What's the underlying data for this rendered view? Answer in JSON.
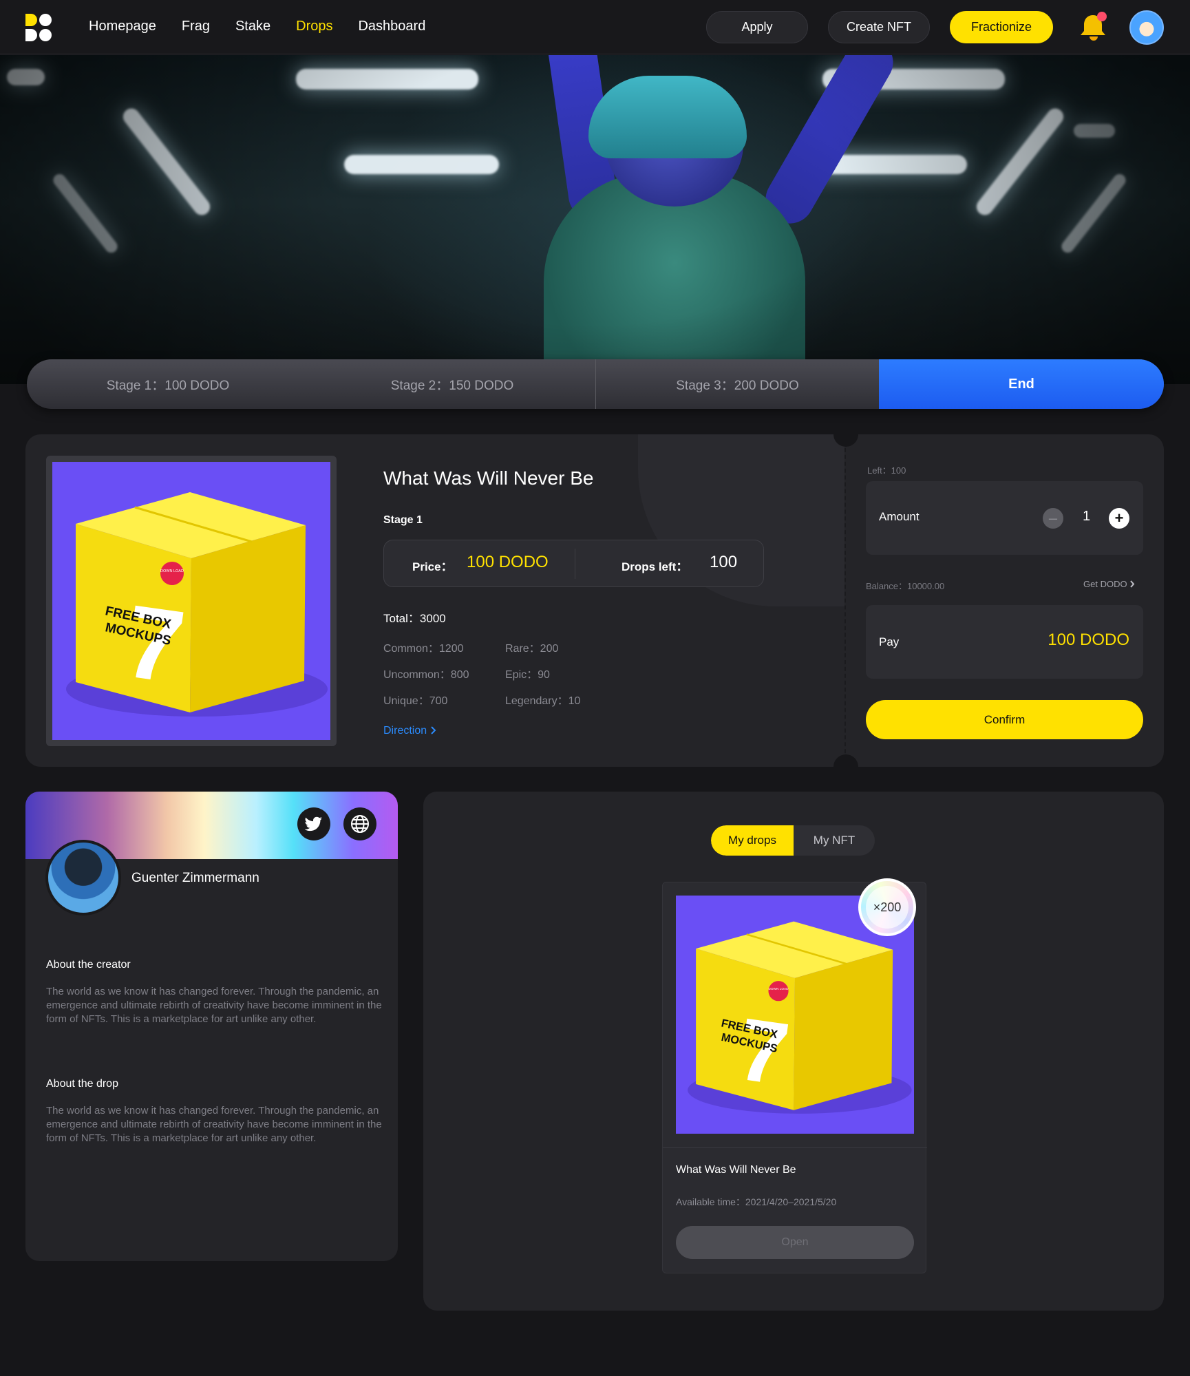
{
  "nav": {
    "links": [
      "Homepage",
      "Frag",
      "Stake",
      "Drops",
      "Dashboard"
    ],
    "active": "Drops",
    "apply_label": "Apply",
    "create_label": "Create NFT",
    "fractionize_label": "Fractionize"
  },
  "stages": {
    "s1": "Stage 1：100 DODO",
    "s2": "Stage 2：150 DODO",
    "s3": "Stage 3：200 DODO",
    "end": "End"
  },
  "drop": {
    "title": "What Was Will Never Be",
    "stage": "Stage 1",
    "price_label": "Price：",
    "price_value": "100 DODO",
    "drops_left_label": "Drops left：",
    "drops_left_value": "100",
    "total": "Total：3000",
    "rarity": {
      "common": "Common：1200",
      "rare": "Rare：200",
      "uncommon": "Uncommon：800",
      "epic": "Epic：90",
      "unique": "Unique：700",
      "legendary": "Legendary：10"
    },
    "direction": "Direction"
  },
  "purchase": {
    "left": "Left：100",
    "amount_label": "Amount",
    "amount_value": "1",
    "balance": "Balance：10000.00",
    "get_dodo": "Get DODO",
    "pay_label": "Pay",
    "pay_value": "100 DODO",
    "confirm": "Confirm"
  },
  "creator": {
    "name": "Guenter Zimmermann",
    "about_creator_title": "About the creator",
    "about_creator_body": "The world as we know it has changed forever. Through the pandemic, an emergence and ultimate rebirth of creativity have become imminent in the form of NFTs. This is a marketplace for art unlike any other.",
    "about_drop_title": "About the drop",
    "about_drop_body": "The world as we know it has changed forever. Through the pandemic, an emergence and ultimate rebirth of creativity have become imminent in the form of NFTs. This is a marketplace for art unlike any other."
  },
  "panel": {
    "tab_drops": "My drops",
    "tab_nft": "My NFT",
    "card_title": "What Was Will Never Be",
    "card_time": "Available time：2021/4/20–2021/5/20",
    "badge": "×200",
    "open": "Open"
  },
  "box_art": {
    "line1": "FREE BOX",
    "line2": "MOCKUPS",
    "digit": "7",
    "sticker": "DOWN LOAD"
  },
  "colors": {
    "accent": "#ffe100",
    "blue": "#1d5cf0",
    "link": "#2b8cff",
    "art_bg": "#6a4ff5"
  },
  "icons": [
    "logo-icon",
    "bell-icon",
    "twitter-icon",
    "globe-icon",
    "chevron-right-icon",
    "minus-icon",
    "plus-icon"
  ]
}
